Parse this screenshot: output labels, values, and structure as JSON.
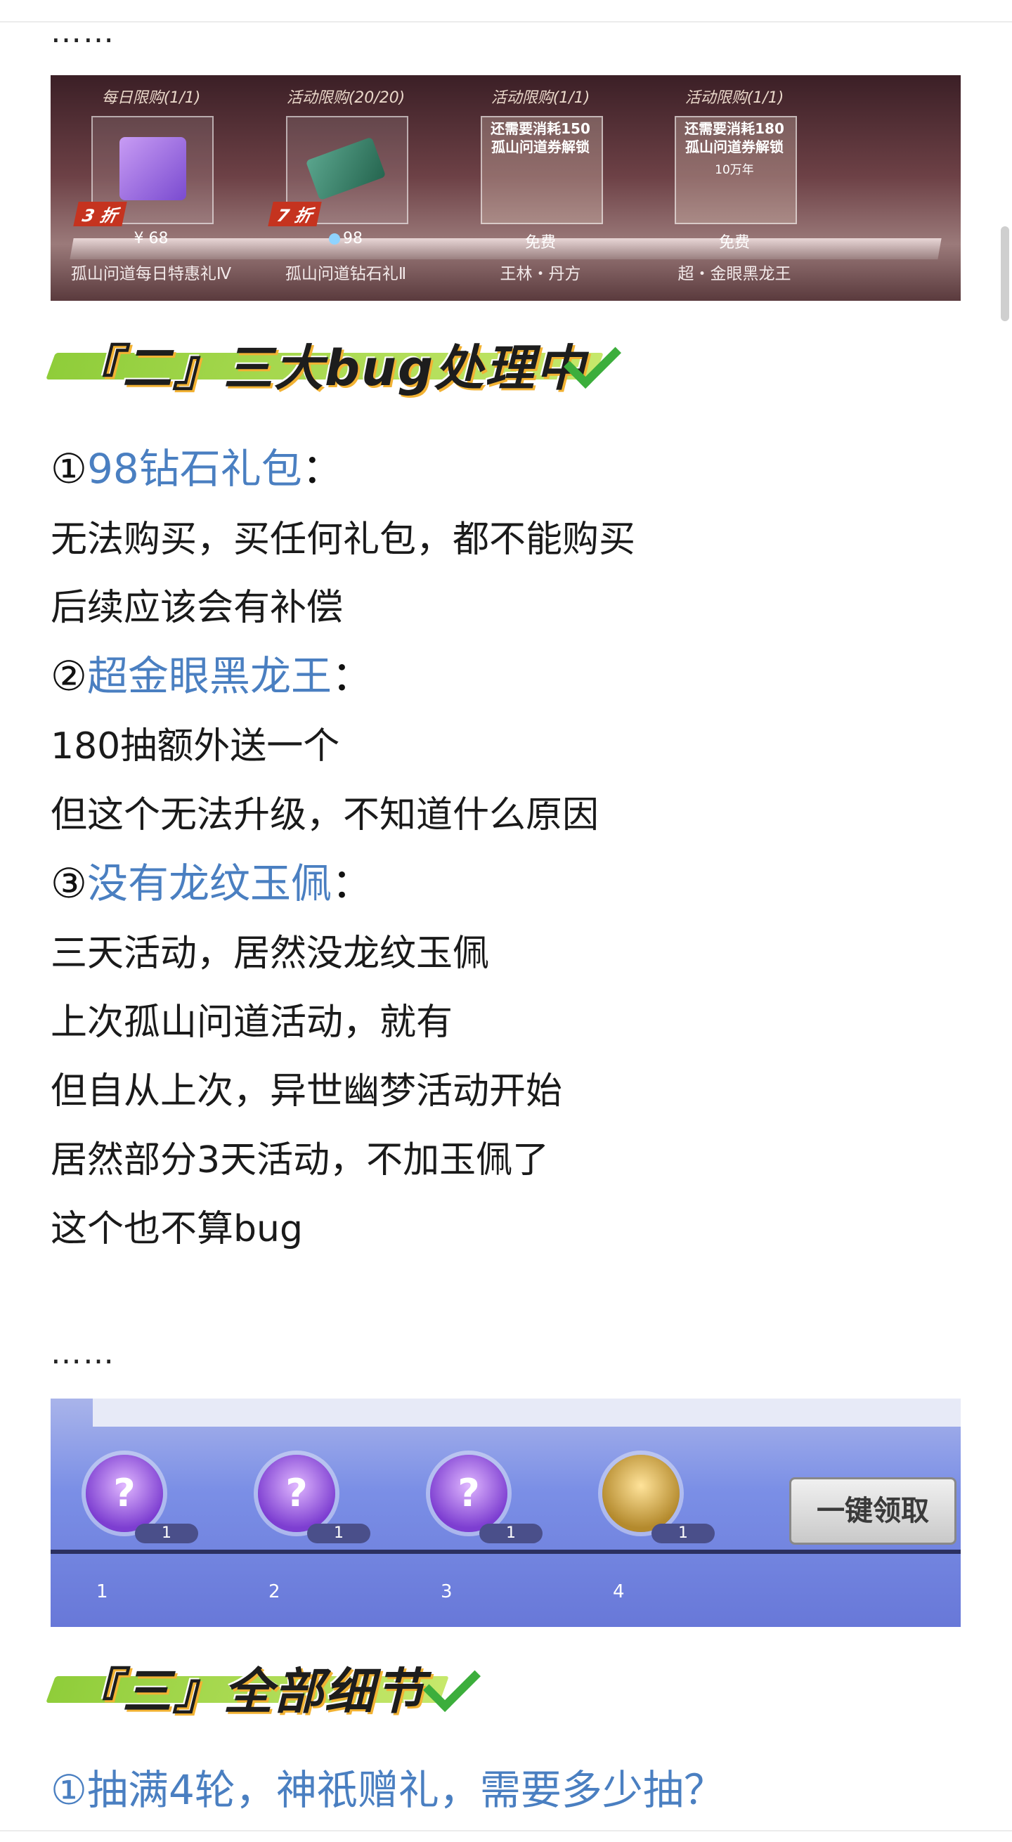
{
  "top_dots": "……",
  "shop_banner": {
    "items": [
      {
        "tag": "每日限购(1/1)",
        "discount": "3 折",
        "price": "¥  68",
        "name": "孤山问道每日特惠礼Ⅳ"
      },
      {
        "tag": "活动限购(20/20)",
        "discount": "7 折",
        "price": "98",
        "name": "孤山问道钻石礼Ⅱ"
      },
      {
        "tag": "活动限购(1/1)",
        "lock_msg": "还需要消耗150\n孤山问道券解锁",
        "price": "免费",
        "name": "王林・丹方"
      },
      {
        "tag": "活动限购(1/1)",
        "lock_msg": "还需要消耗180\n孤山问道券解锁",
        "lock_extra": "10万年",
        "price": "免费",
        "name": "超・金眼黑龙王"
      }
    ]
  },
  "section2_title": "『二』三大bug处理中",
  "s2": {
    "h1": {
      "num": "①",
      "link": "98钻石礼包",
      "colon": "："
    },
    "p1": "无法购买，买任何礼包，都不能购买",
    "p2": "后续应该会有补偿",
    "h2": {
      "num": "②",
      "link": "超金眼黑龙王",
      "colon": "："
    },
    "p3": "180抽额外送一个",
    "p4": "但这个无法升级，不知道什么原因",
    "h3": {
      "num": "③",
      "link": "没有龙纹玉佩",
      "colon": "："
    },
    "p5": "三天活动，居然没龙纹玉佩",
    "p6": "上次孤山问道活动，就有",
    "p7": "但自从上次，异世幽梦活动开始",
    "p8": "居然部分3天活动，不加玉佩了",
    "p9": "这个也不算bug"
  },
  "mid_dots": "……",
  "rewards_banner": {
    "nodes": [
      {
        "icon": "?",
        "count": "1",
        "index": "1"
      },
      {
        "icon": "?",
        "count": "1",
        "index": "2"
      },
      {
        "icon": "?",
        "count": "1",
        "index": "3"
      },
      {
        "icon": "",
        "count": "1",
        "index": "4"
      }
    ],
    "claim_label": "一键领取"
  },
  "section3_title": "『三』全部细节",
  "s3": {
    "h1": "①抽满4轮，神祇赠礼，需要多少抽？"
  }
}
